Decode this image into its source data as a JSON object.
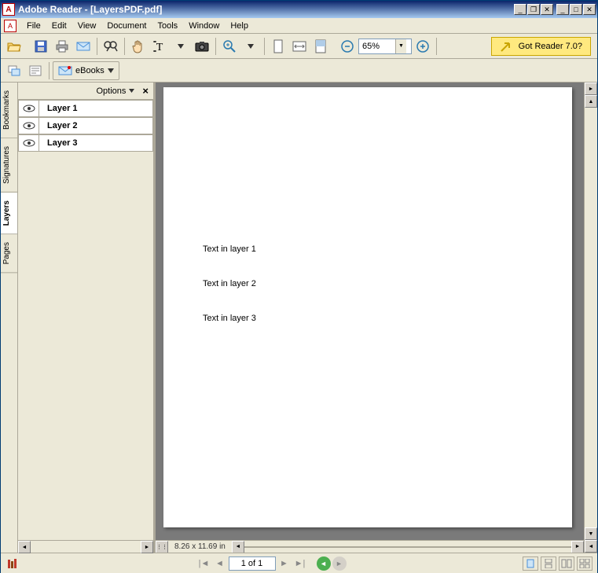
{
  "window": {
    "title": "Adobe Reader - [LayersPDF.pdf]"
  },
  "menu": {
    "items": [
      "File",
      "Edit",
      "View",
      "Document",
      "Tools",
      "Window",
      "Help"
    ]
  },
  "toolbar": {
    "zoom_value": "65%",
    "ebooks_label": "eBooks",
    "promo_text": "Got Reader 7.0?"
  },
  "side_tabs": [
    "Bookmarks",
    "Signatures",
    "Layers",
    "Pages"
  ],
  "panel": {
    "options_label": "Options",
    "layers": [
      "Layer 1",
      "Layer 2",
      "Layer 3"
    ]
  },
  "document": {
    "dimensions": "8.26 x 11.69 in",
    "texts": [
      "Text in layer 1",
      "Text in layer 2",
      "Text in layer 3"
    ]
  },
  "status": {
    "page_display": "1 of 1"
  }
}
